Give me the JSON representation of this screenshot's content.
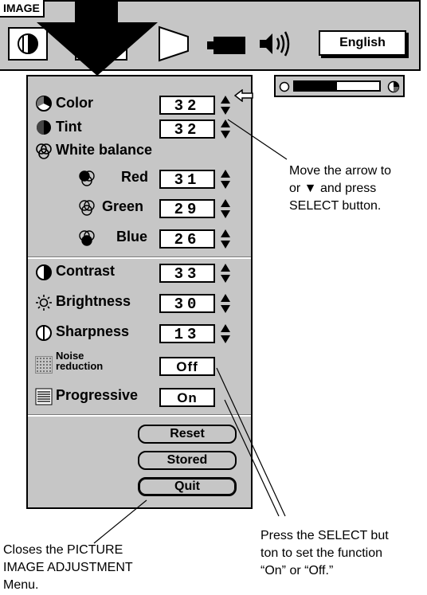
{
  "topbar": {
    "tab_label": "IMAGE",
    "language_button": "English",
    "icons": [
      "contrast-half-icon",
      "picture-screen-icon",
      "screen-projector-icon",
      "speaker-volume-icon"
    ]
  },
  "menu": {
    "items": [
      {
        "label": "Color",
        "value": "32",
        "icon": "color-dial-icon"
      },
      {
        "label": "Tint",
        "value": "32",
        "icon": "tint-drop-icon"
      },
      {
        "label": "White balance",
        "icon": "white-balance-icon"
      },
      {
        "label": "Red",
        "value": "31",
        "icon": "red-balance-icon"
      },
      {
        "label": "Green",
        "value": "29",
        "icon": "green-balance-icon"
      },
      {
        "label": "Blue",
        "value": "26",
        "icon": "blue-balance-icon"
      },
      {
        "label": "Contrast",
        "value": "33",
        "icon": "contrast-icon"
      },
      {
        "label": "Brightness",
        "value": "30",
        "icon": "brightness-sun-icon"
      },
      {
        "label": "Sharpness",
        "value": "13",
        "icon": "sharpness-icon"
      },
      {
        "label_line1": "Noise",
        "label_line2": "reduction",
        "value": "Off",
        "icon": "noise-reduction-icon"
      },
      {
        "label": "Progressive",
        "value": "On",
        "icon": "progressive-lines-icon"
      }
    ],
    "buttons": {
      "reset": "Reset",
      "stored": "Stored",
      "quit": "Quit"
    }
  },
  "slider": {
    "level": 0.5
  },
  "annotations": {
    "arrow_note": [
      "Move the arrow to",
      "or ▼  and press",
      "SELECT button."
    ],
    "select_note": [
      "Press the SELECT but",
      "ton to set the function",
      "“On” or “Off.”"
    ],
    "quit_note": [
      "Closes the PICTURE",
      "IMAGE ADJUSTMENT",
      "Menu."
    ]
  }
}
